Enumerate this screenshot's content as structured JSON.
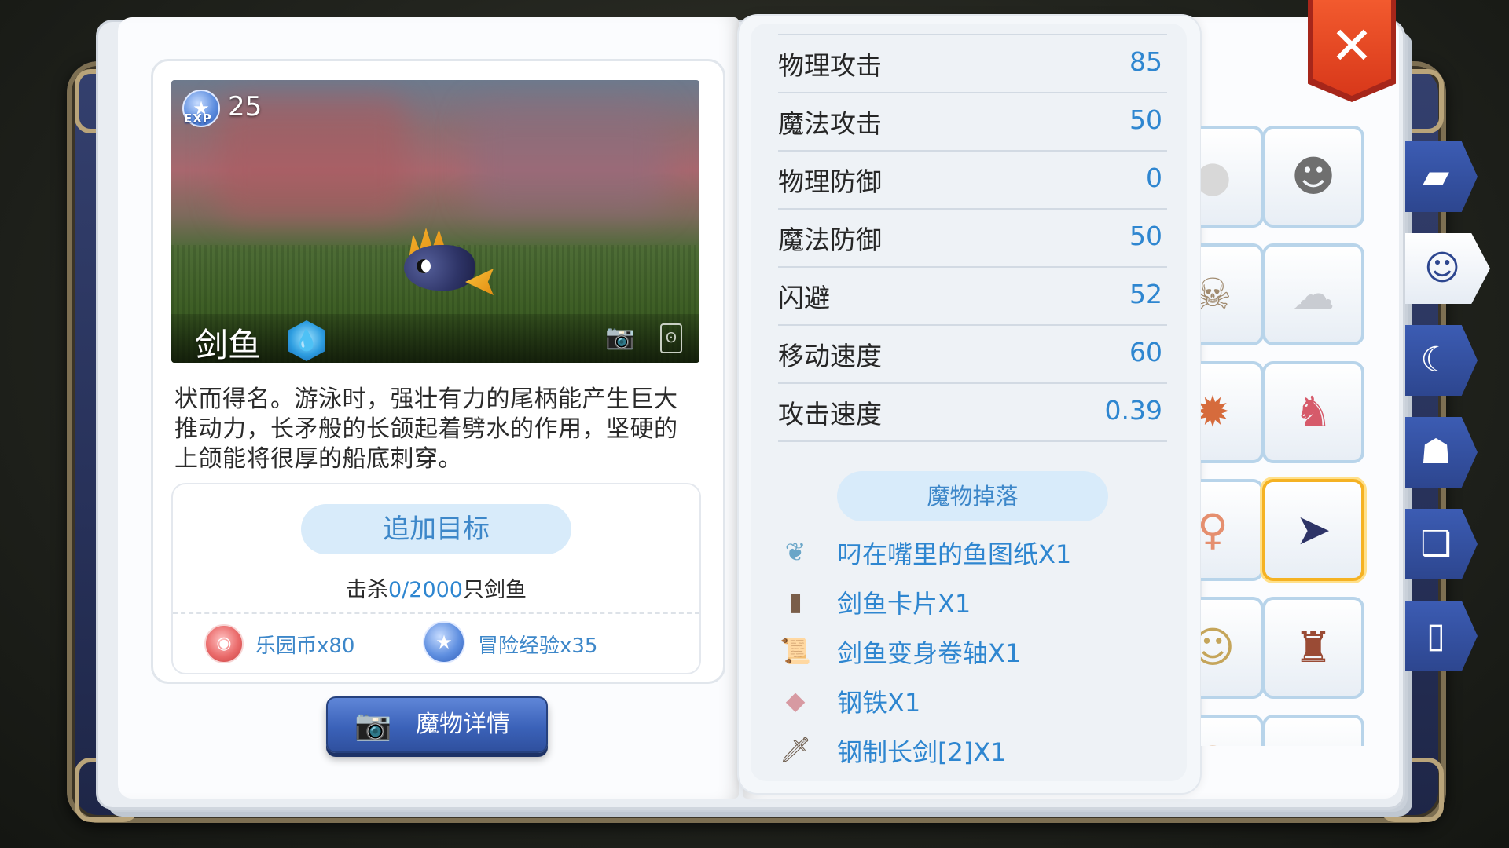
{
  "close": {
    "label": "✕"
  },
  "monster": {
    "exp_word": "EXP",
    "level": "25",
    "name": "剑鱼",
    "description": "状而得名。游泳时，强壮有力的尾柄能产生巨大推动力，长矛般的长颌起着劈水的作用，坚硬的上颌能将很厚的船底刺穿。"
  },
  "target": {
    "button_label": "追加目标",
    "kill_prefix": "击杀",
    "kill_progress": "0/2000",
    "kill_suffix": "只剑鱼",
    "rewards": [
      {
        "icon": "park-coin-icon",
        "label": "乐园币x80"
      },
      {
        "icon": "exp-star-icon",
        "label": "冒险经验x35"
      }
    ]
  },
  "detail_button": {
    "label": "魔物详情"
  },
  "stats": [
    {
      "label": "物理攻击",
      "value": "85"
    },
    {
      "label": "魔法攻击",
      "value": "50"
    },
    {
      "label": "物理防御",
      "value": "0"
    },
    {
      "label": "魔法防御",
      "value": "50"
    },
    {
      "label": "闪避",
      "value": "52"
    },
    {
      "label": "移动速度",
      "value": "60"
    },
    {
      "label": "攻击速度",
      "value": "0.39"
    }
  ],
  "drops": {
    "title": "魔物掉落",
    "items": [
      {
        "icon": "fish-blueprint-icon",
        "name": "叼在嘴里的鱼图纸X1"
      },
      {
        "icon": "card-icon",
        "name": "剑鱼卡片X1"
      },
      {
        "icon": "scroll-icon",
        "name": "剑鱼变身卷轴X1"
      },
      {
        "icon": "steel-icon",
        "name": "钢铁X1"
      },
      {
        "icon": "sword-icon",
        "name": "钢制长剑[2]X1"
      }
    ]
  },
  "grid": [
    {
      "icon": "poring-icon",
      "selected": false
    },
    {
      "icon": "devil-poring-icon",
      "selected": false
    },
    {
      "icon": "skeleton-icon",
      "selected": false
    },
    {
      "icon": "ghost-icon",
      "selected": false
    },
    {
      "icon": "crab-icon",
      "selected": false
    },
    {
      "icon": "frog-icon",
      "selected": false
    },
    {
      "icon": "mermaid-icon",
      "selected": false
    },
    {
      "icon": "swordfish-icon",
      "selected": true
    },
    {
      "icon": "goblin-icon",
      "selected": false
    },
    {
      "icon": "warrior-icon",
      "selected": false
    }
  ],
  "side_tabs": [
    {
      "icon": "book-icon",
      "active": false
    },
    {
      "icon": "monster-face-icon",
      "active": true
    },
    {
      "icon": "horn-icon",
      "active": false
    },
    {
      "icon": "npc-icon",
      "active": false
    },
    {
      "icon": "open-book-icon",
      "active": false
    },
    {
      "icon": "card-tab-icon",
      "active": false
    }
  ],
  "colors": {
    "accent_blue": "#2e86d0",
    "selected_border": "#f5b223",
    "close_red": "#e2461f",
    "book_cover": "#2d3a68"
  }
}
